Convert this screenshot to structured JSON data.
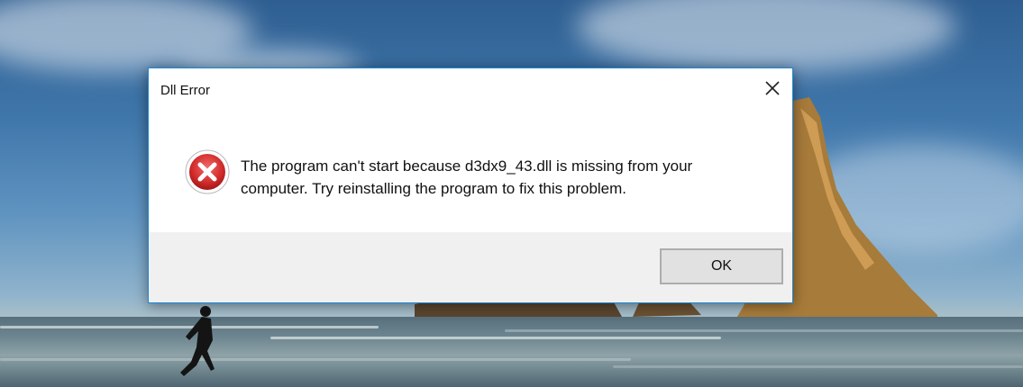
{
  "dialog": {
    "title": "Dll Error",
    "message_line1": "The program can't start because d3dx9_43.dll is missing from your",
    "message_line2": "computer. Try reinstalling the program to fix this problem.",
    "ok_label": "OK",
    "icon": "error-icon",
    "accent_color": "#1a87d6"
  }
}
